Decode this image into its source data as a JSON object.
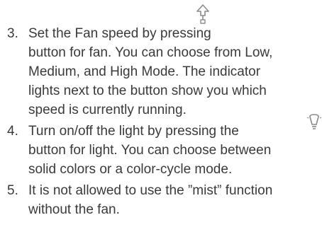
{
  "steps": [
    {
      "number": "3.",
      "lines": [
        "Set the Fan speed by pressing",
        "button for fan. You can choose from Low,",
        "Medium, and High Mode. The indicator",
        "lights next to the button show you which",
        "speed is currently running."
      ],
      "icon": "fan-arrow-up-icon"
    },
    {
      "number": "4.",
      "lines": [
        "Turn on/off the light by pressing the",
        "button for light. You can choose between",
        "solid colors or a color-cycle mode."
      ],
      "icon": "light-bulb-icon"
    },
    {
      "number": "5.",
      "lines": [
        "It is not allowed to use the ”mist” function",
        "without the fan."
      ]
    }
  ],
  "colors": {
    "text": "#3a3a3a",
    "icon": "#8a8a8a"
  }
}
